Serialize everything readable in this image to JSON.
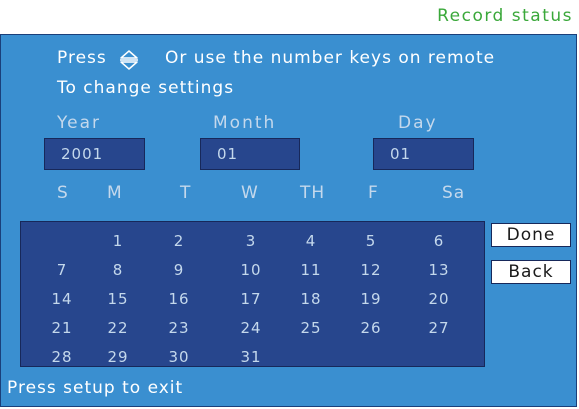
{
  "header": {
    "status": "Record status"
  },
  "instructions": {
    "press": "Press",
    "arrow_icon": "up-down-arrows-icon",
    "or_remote": "Or use the number keys on remote",
    "change": "To change settings"
  },
  "fields": {
    "year": {
      "label": "Year",
      "value": "2001"
    },
    "month": {
      "label": "Month",
      "value": "01"
    },
    "day": {
      "label": "Day",
      "value": "01"
    }
  },
  "weekdays": [
    "S",
    "M",
    "T",
    "W",
    "TH",
    "F",
    "Sa"
  ],
  "calendar": {
    "weeks": [
      [
        "",
        "1",
        "2",
        "3",
        "4",
        "5",
        "6"
      ],
      [
        "7",
        "8",
        "9",
        "10",
        "11",
        "12",
        "13"
      ],
      [
        "14",
        "15",
        "16",
        "17",
        "18",
        "19",
        "20"
      ],
      [
        "21",
        "22",
        "23",
        "24",
        "25",
        "26",
        "27"
      ],
      [
        "28",
        "29",
        "30",
        "31",
        "",
        "",
        ""
      ]
    ]
  },
  "buttons": {
    "done": "Done",
    "back": "Back"
  },
  "footer": {
    "text": "Press  setup to exit"
  },
  "colors": {
    "panel": "#3a8fd0",
    "field": "#27468d",
    "status_text": "#3aa83a",
    "soft_text": "#c4d8ec"
  }
}
